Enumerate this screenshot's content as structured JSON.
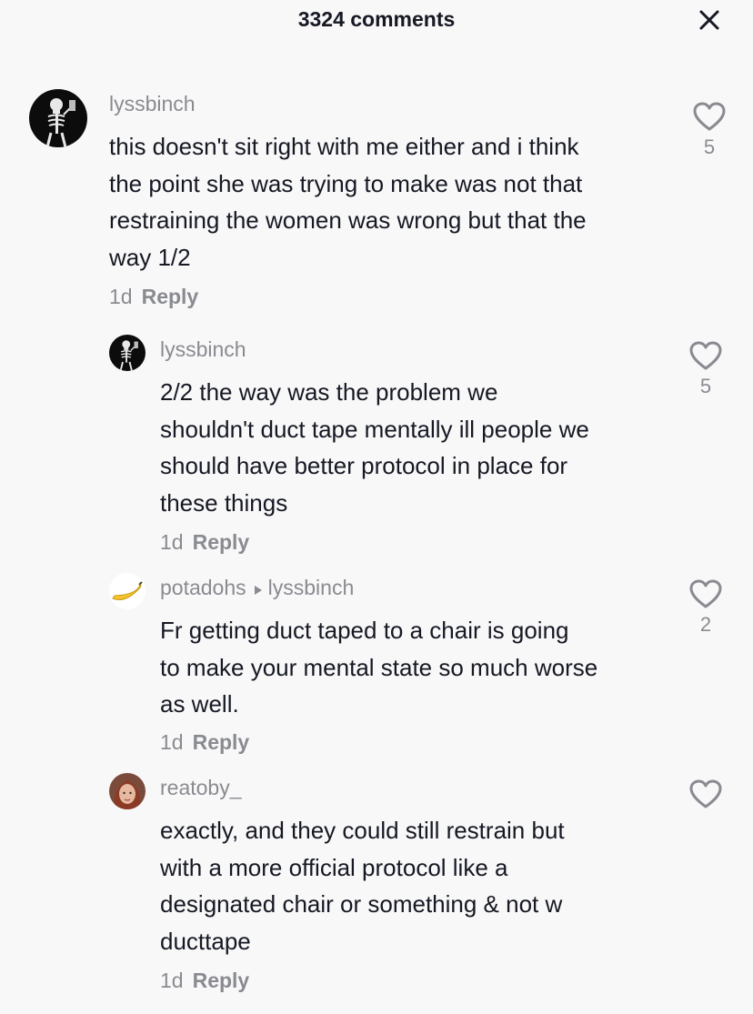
{
  "header": {
    "title": "3324 comments",
    "close_icon": "close-icon"
  },
  "comments": [
    {
      "username": "lyssbinch",
      "reply_to": "",
      "lines": [
        "this doesn't sit right with me either and i think",
        "the point she was trying to make was not that",
        "restraining the women was wrong but that the",
        "way 1/2"
      ],
      "time": "1d",
      "reply_label": "Reply",
      "likes": "5",
      "avatar": "skeleton-avatar"
    },
    {
      "username": "lyssbinch",
      "reply_to": "",
      "lines": [
        "2/2 the way was the problem we",
        "shouldn't duct tape mentally ill people we",
        "should have better protocol in place for",
        "these things"
      ],
      "time": "1d",
      "reply_label": "Reply",
      "likes": "5",
      "avatar": "skeleton-avatar"
    },
    {
      "username": "potadohs",
      "reply_to": "lyssbinch",
      "lines": [
        "Fr getting duct taped to a chair is going",
        "to make your mental state so much worse",
        "as well."
      ],
      "time": "1d",
      "reply_label": "Reply",
      "likes": "2",
      "avatar": "banana-avatar"
    },
    {
      "username": "reatoby_",
      "reply_to": "",
      "lines": [
        "exactly, and they could still restrain but",
        "with a more official protocol like a",
        "designated chair or something & not w",
        "ducttape"
      ],
      "time": "1d",
      "reply_label": "Reply",
      "likes": "",
      "avatar": "photo-avatar"
    }
  ],
  "colors": {
    "background": "#f8f8f8",
    "text": "#161823",
    "secondary": "#8a8b91"
  }
}
